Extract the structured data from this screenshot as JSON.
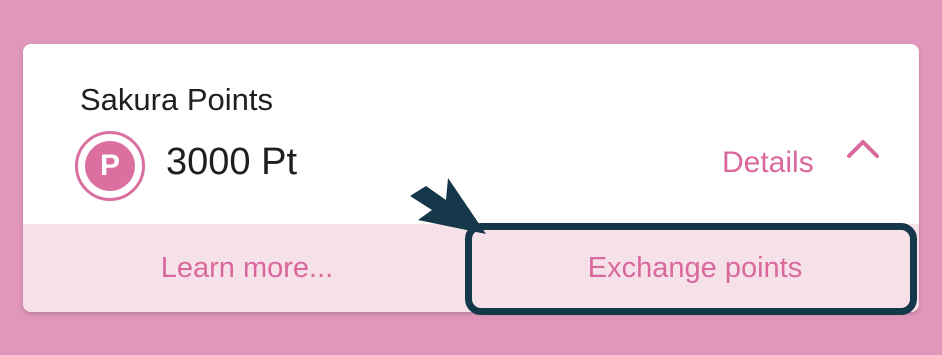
{
  "colors": {
    "background": "#e197bb",
    "accent": "#d9699c",
    "button_bg": "#f7e1e9",
    "highlight": "#15374a"
  },
  "card": {
    "title": "Sakura Points",
    "points_icon_letter": "P",
    "points_value": "3000 Pt",
    "details_label": "Details",
    "chevron_icon": "chevron-up-icon"
  },
  "actions": {
    "learn_more_label": "Learn more...",
    "exchange_label": "Exchange points"
  }
}
